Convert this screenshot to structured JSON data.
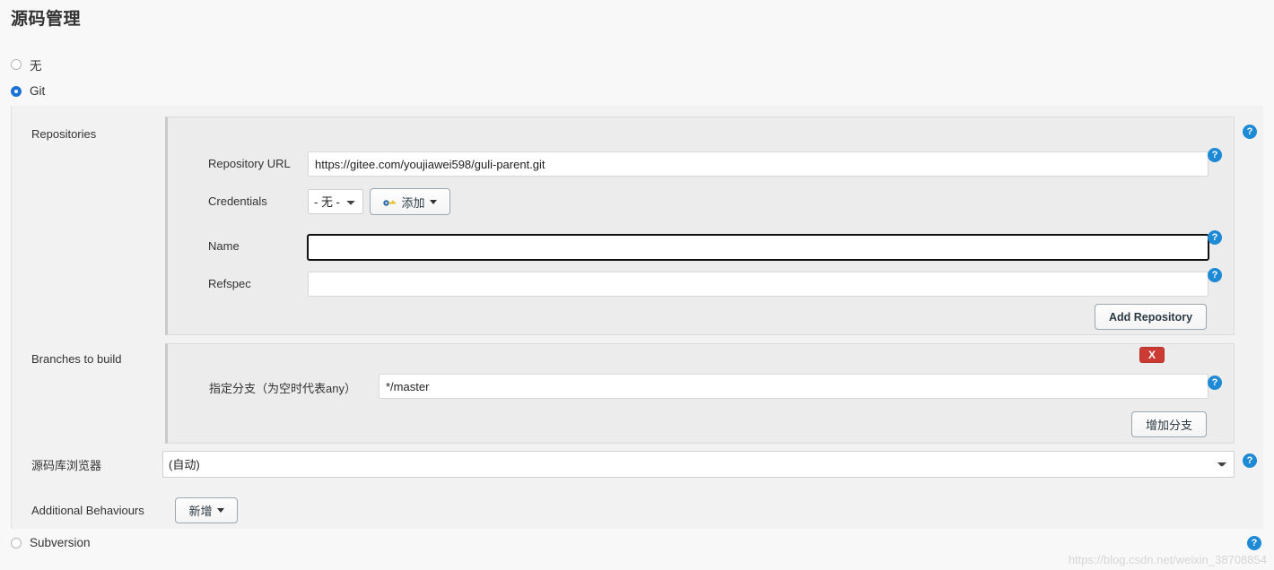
{
  "page": {
    "title": "源码管理",
    "watermark": "https://blog.csdn.net/weixin_38708854"
  },
  "scm_options": [
    {
      "label": "无",
      "selected": false
    },
    {
      "label": "Git",
      "selected": true
    },
    {
      "label": "Subversion",
      "selected": false
    }
  ],
  "git": {
    "repositories": {
      "section_label": "Repositories",
      "repository_url": {
        "label": "Repository URL",
        "value": "https://gitee.com/youjiawei598/guli-parent.git"
      },
      "credentials": {
        "label": "Credentials",
        "selected": "- 无 -",
        "options": [
          "- 无 -"
        ],
        "add_button": "添加"
      },
      "name": {
        "label": "Name",
        "value": "",
        "focused": true
      },
      "refspec": {
        "label": "Refspec",
        "value": ""
      },
      "add_repository_button": "Add Repository"
    },
    "branches": {
      "section_label": "Branches to build",
      "branch_spec": {
        "label": "指定分支（为空时代表any）",
        "value": "*/master"
      },
      "delete_button": "X",
      "add_branch_button": "增加分支"
    },
    "repository_browser": {
      "label": "源码库浏览器",
      "selected": "(自动)",
      "options": [
        "(自动)"
      ]
    },
    "additional_behaviours": {
      "label": "Additional Behaviours",
      "add_button": "新增"
    }
  },
  "help_icon": "?",
  "colors": {
    "accent": "#1e8ad6",
    "radio_checked": "#1a73d4",
    "delete": "#cc3b33",
    "panel_bg": "#ececec",
    "page_bg": "#f8f8f8"
  }
}
